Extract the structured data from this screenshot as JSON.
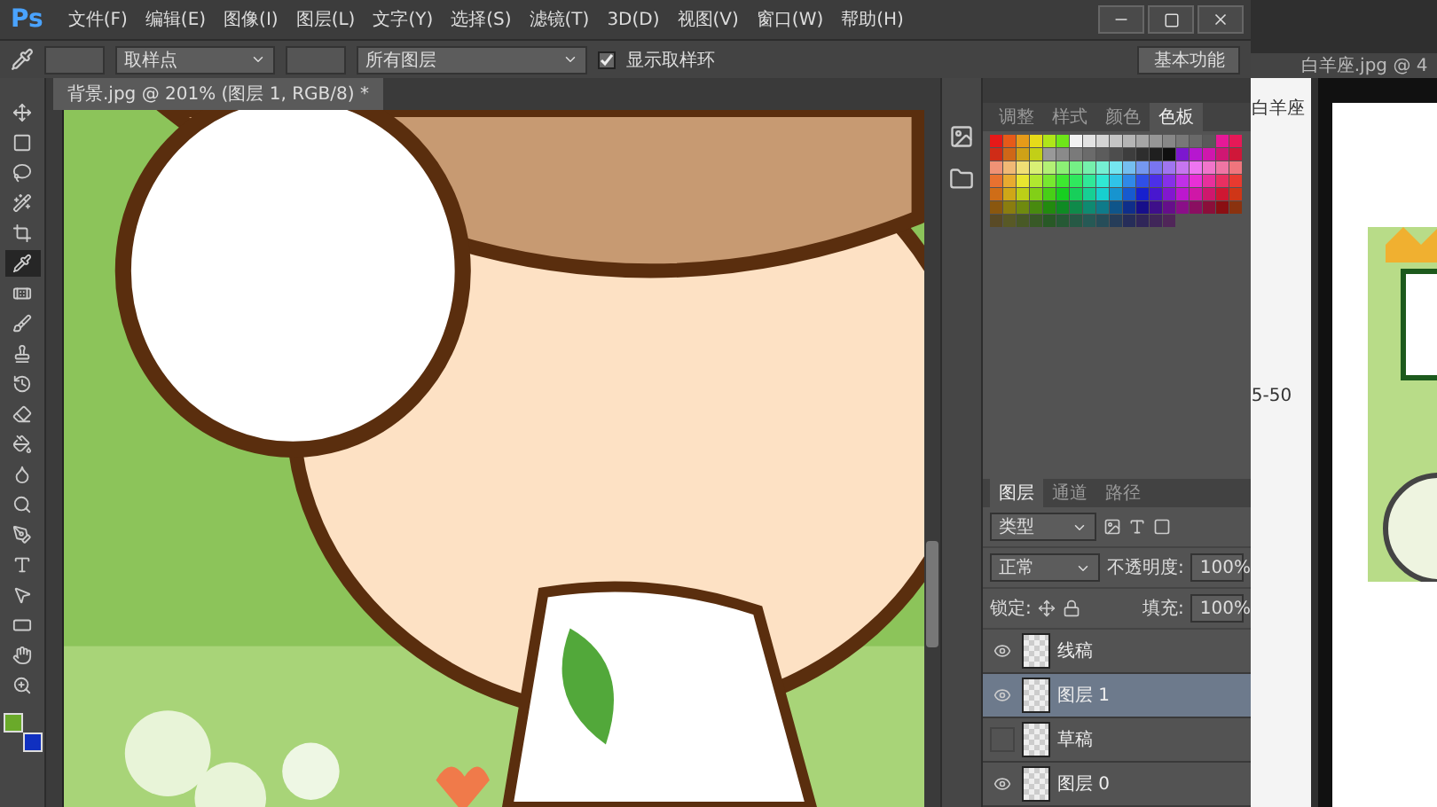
{
  "app": {
    "logo": "Ps"
  },
  "menu": [
    "文件(F)",
    "编辑(E)",
    "图像(I)",
    "图层(L)",
    "文字(Y)",
    "选择(S)",
    "滤镜(T)",
    "3D(D)",
    "视图(V)",
    "窗口(W)",
    "帮助(H)"
  ],
  "options": {
    "sample_size": "取样点",
    "sample": "所有图层",
    "show_ring": {
      "label": "显示取样环",
      "checked": true
    },
    "workspace": "基本功能"
  },
  "tools": [
    {
      "kind": "move",
      "selected": false
    },
    {
      "kind": "marquee",
      "selected": false
    },
    {
      "kind": "lasso",
      "selected": false
    },
    {
      "kind": "wand",
      "selected": false
    },
    {
      "kind": "crop",
      "selected": false
    },
    {
      "kind": "eyedropper",
      "selected": true
    },
    {
      "kind": "healing",
      "selected": false
    },
    {
      "kind": "brush",
      "selected": false
    },
    {
      "kind": "stamp",
      "selected": false
    },
    {
      "kind": "history",
      "selected": false
    },
    {
      "kind": "eraser",
      "selected": false
    },
    {
      "kind": "bucket",
      "selected": false
    },
    {
      "kind": "blur",
      "selected": false
    },
    {
      "kind": "dodge",
      "selected": false
    },
    {
      "kind": "pen",
      "selected": false
    },
    {
      "kind": "type",
      "selected": false
    },
    {
      "kind": "select",
      "selected": false
    },
    {
      "kind": "shape",
      "selected": false
    },
    {
      "kind": "hand",
      "selected": false
    },
    {
      "kind": "zoom",
      "selected": false
    }
  ],
  "document": {
    "tab": "背景.jpg @ 201% (图层 1, RGB/8) *"
  },
  "swatches_panel": {
    "tabs": [
      {
        "label": "调整",
        "selected": false
      },
      {
        "label": "样式",
        "selected": false
      },
      {
        "label": "颜色",
        "selected": false
      },
      {
        "label": "色板",
        "selected": true
      }
    ]
  },
  "layers_panel": {
    "tabs": [
      {
        "label": "图层",
        "selected": true
      },
      {
        "label": "通道",
        "selected": false
      },
      {
        "label": "路径",
        "selected": false
      }
    ],
    "filter": "类型",
    "blend_mode": "正常",
    "opacity_label": "不透明度:",
    "opacity": "100%",
    "lock_label": "锁定:",
    "fill_label": "填充:",
    "fill": "100%",
    "layers": [
      {
        "name": "线稿",
        "visible": true,
        "selected": false
      },
      {
        "name": "图层 1",
        "visible": true,
        "selected": true
      },
      {
        "name": "草稿",
        "visible": false,
        "selected": false
      },
      {
        "name": "图层 0",
        "visible": true,
        "selected": false
      }
    ]
  },
  "background_window": {
    "title": "白羊座.jpg @ 4",
    "page_title": "白羊座",
    "page_text": "5-50"
  }
}
